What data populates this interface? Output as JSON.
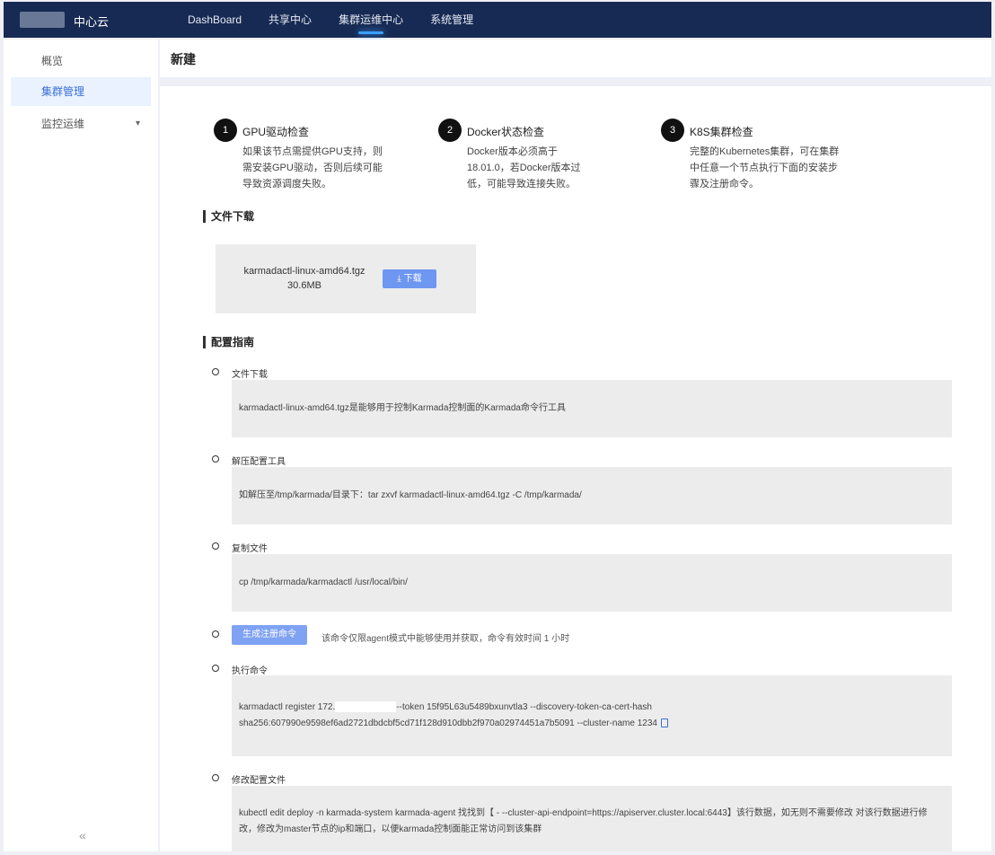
{
  "header": {
    "brand": "中心云",
    "nav": [
      "DashBoard",
      "共享中心",
      "集群运维中心",
      "系统管理"
    ]
  },
  "sidebar": {
    "items": [
      {
        "label": "概览"
      },
      {
        "label": "集群管理"
      },
      {
        "label": "监控运维"
      }
    ],
    "collapse_symbol": "«"
  },
  "main": {
    "title": "新建",
    "steps": [
      {
        "num": "1",
        "title": "GPU驱动检查",
        "desc": "如果该节点需提供GPU支持，则需安装GPU驱动，否则后续可能导致资源调度失败。"
      },
      {
        "num": "2",
        "title": "Docker状态检查",
        "desc": "Docker版本必须高于18.01.0，若Docker版本过低，可能导致连接失败。"
      },
      {
        "num": "3",
        "title": "K8S集群检查",
        "desc": "完整的Kubernetes集群，可在集群中任意一个节点执行下面的安装步骤及注册命令。"
      }
    ],
    "download": {
      "heading": "文件下载",
      "file_name": "karmadactl-linux-amd64.tgz",
      "file_size": "30.6MB",
      "button": "⤓ 下载"
    },
    "guide": {
      "heading": "配置指南",
      "file_label": "文件下载",
      "file_text": "karmadactl-linux-amd64.tgz是能够用于控制Karmada控制面的Karmada命令行工具",
      "unzip_label": "解压配置工具",
      "unzip_text": "如解压至/tmp/karmada/目录下：tar zxvf karmadactl-linux-amd64.tgz -C /tmp/karmada/",
      "copy_label": "复制文件",
      "copy_text": "cp /tmp/karmada/karmadactl /usr/local/bin/",
      "gen_button": "生成注册命令",
      "gen_hint": "该命令仅限agent模式中能够使用并获取，命令有效时间 1 小时",
      "exec_label": "执行命令",
      "exec_line1_a": "karmadactl register 172.",
      "exec_line1_b": "--token 15f95L63u5489bxunvtla3 --discovery-token-ca-cert-hash",
      "exec_line2": "sha256:607990e9598ef6ad2721dbdcbf5cd71f128d910dbb2f970a02974451a7b5091 --cluster-name 1234",
      "modify_label": "修改配置文件",
      "modify_text": "kubectl edit deploy -n karmada-system karmada-agent 找找到【 - --cluster-api-endpoint=https://apiserver.cluster.local:6443】该行数据，如无则不需要修改 对该行数据进行修改，修改为master节点的ip和端口，以便karmada控制面能正常访问到该集群"
    }
  }
}
